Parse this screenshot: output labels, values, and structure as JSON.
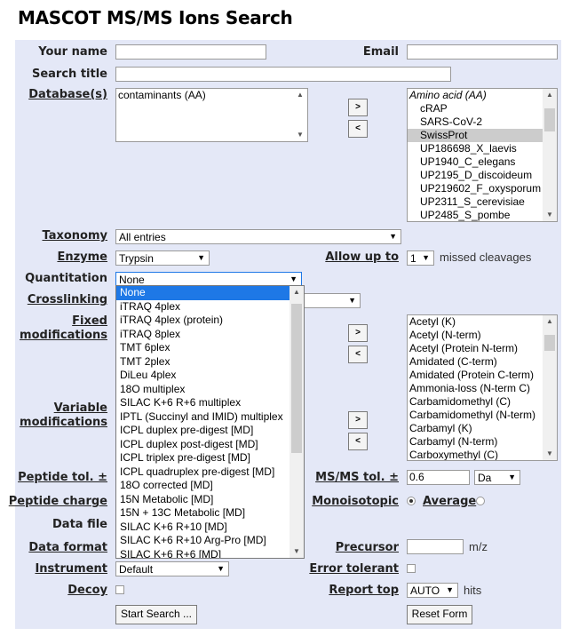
{
  "page_title": "MASCOT MS/MS Ions Search",
  "labels": {
    "your_name": "Your name",
    "email": "Email",
    "search_title": "Search title",
    "databases": "Database(s)",
    "taxonomy": "Taxonomy",
    "enzyme": "Enzyme",
    "allow_up_to": "Allow up to",
    "missed_cleavages": "missed cleavages",
    "quantitation": "Quantitation",
    "crosslinking": "Crosslinking",
    "fixed_mods_1": "Fixed",
    "fixed_mods_2": "modifications",
    "var_mods_1": "Variable",
    "var_mods_2": "modifications",
    "peptide_tol": "Peptide tol. ±",
    "msms_tol": "MS/MS tol. ±",
    "peptide_charge": "Peptide charge",
    "monoisotopic": "Monoisotopic",
    "average": "Average",
    "data_file": "Data file",
    "data_format": "Data format",
    "precursor": "Precursor",
    "mz": "m/z",
    "instrument": "Instrument",
    "error_tolerant": "Error tolerant",
    "decoy": "Decoy",
    "report_top": "Report top",
    "hits": "hits"
  },
  "fields": {
    "selected_databases": [
      "contaminants (AA)"
    ],
    "taxonomy": "All entries",
    "enzyme": "Trypsin",
    "missed_cleavages": "1",
    "quantitation": "None",
    "msms_tol_value": "0.6",
    "msms_tol_unit": "Da",
    "instrument": "Default",
    "report_top": "AUTO"
  },
  "available_databases": {
    "group_header": "Amino acid (AA)",
    "items": [
      "cRAP",
      "SARS-CoV-2",
      "SwissProt",
      "UP186698_X_laevis",
      "UP1940_C_elegans",
      "UP2195_D_discoideum",
      "UP219602_F_oxysporum",
      "UP2311_S_cerevisiae",
      "UP2485_S_pombe"
    ],
    "highlighted": "SwissProt"
  },
  "modifications": [
    "Acetyl (K)",
    "Acetyl (N-term)",
    "Acetyl (Protein N-term)",
    "Amidated (C-term)",
    "Amidated (Protein C-term)",
    "Ammonia-loss (N-term C)",
    "Carbamidomethyl (C)",
    "Carbamidomethyl (N-term)",
    "Carbamyl (K)",
    "Carbamyl (N-term)",
    "Carboxymethyl (C)"
  ],
  "quantitation_options": [
    "None",
    "iTRAQ 4plex",
    "iTRAQ 4plex (protein)",
    "iTRAQ 8plex",
    "TMT 6plex",
    "TMT 2plex",
    "DiLeu 4plex",
    "18O multiplex",
    "SILAC K+6 R+6 multiplex",
    "IPTL (Succinyl and IMID) multiplex",
    "ICPL duplex pre-digest [MD]",
    "ICPL duplex post-digest [MD]",
    "ICPL triplex pre-digest [MD]",
    "ICPL quadruplex pre-digest [MD]",
    "18O corrected [MD]",
    "15N Metabolic [MD]",
    "15N + 13C Metabolic [MD]",
    "SILAC K+6 R+10 [MD]",
    "SILAC K+6 R+10 Arg-Pro [MD]",
    "SILAC K+6 R+6 [MD]"
  ],
  "buttons": {
    "add": ">",
    "remove": "<",
    "start_search": "Start Search ...",
    "reset_form": "Reset Form"
  },
  "icons": {
    "dropdown": "▼",
    "scroll_up": "▲",
    "scroll_down": "▼"
  },
  "colors": {
    "panel_bg": "#e4e8f7",
    "selection": "#1e78e6",
    "highlight": "#cccccc"
  }
}
